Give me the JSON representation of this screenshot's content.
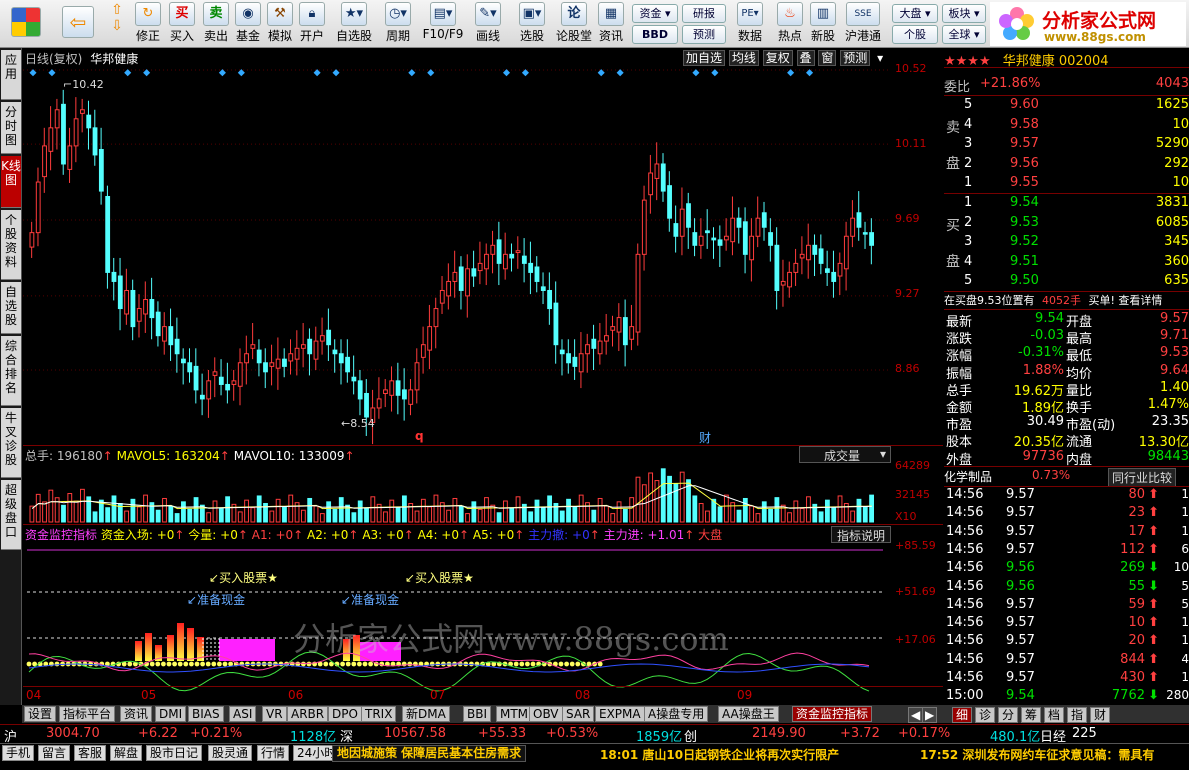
{
  "toolbar": {
    "buy": "买入",
    "sell": "卖出",
    "fund": "基金",
    "simulate": "模拟",
    "open_account": "开户",
    "fix": "修正",
    "watchlist": "自选股",
    "period": "周期",
    "f10": "F10/F9",
    "draw": "画线",
    "stock_pick": "选股",
    "forum": "论股堂",
    "info": "资讯",
    "funds_btn": "资金",
    "bbd": "BBD",
    "research": "研报",
    "forecast": "预测",
    "data": "数据",
    "hot": "热点",
    "new_stock": "新股",
    "hk_connect": "沪港通",
    "market_big": "大盘",
    "individual": "个股",
    "sector": "板块",
    "global": "全球",
    "logo_title": "分析家公式网",
    "logo_url": "www.88gs.com"
  },
  "left_tabs": [
    "应用",
    "分时图",
    "K线图",
    "个股资料",
    "自选股",
    "综合排名",
    "牛叉诊股",
    "超级盘口"
  ],
  "chart": {
    "kline_label": "日线(复权)",
    "stock_name": "华邦健康",
    "buttons": [
      "加自选",
      "均线",
      "复权",
      "叠",
      "窗",
      "预测"
    ],
    "high_label": "10.42",
    "low_label": "8.54",
    "price_axis": [
      "10.52",
      "10.11",
      "9.69",
      "9.27",
      "8.86"
    ],
    "marker_q": "q",
    "marker_cai": "财",
    "vol_title": "总手: 196180",
    "vol_ma5": "MAVOL5: 163204",
    "vol_ma10": "MAVOL10: 133009",
    "vol_selector": "成交量",
    "vol_axis": [
      "64289",
      "32145",
      "X10"
    ],
    "ind_title": "资金监控指标",
    "ind_entry": "资金入场: +0",
    "ind_today": "今量: +0",
    "ind_a1": "A1: +0",
    "ind_a2": "A2: +0",
    "ind_a3": "A3: +0",
    "ind_a4": "A4: +0",
    "ind_a5": "A5: +0",
    "ind_main_out": "主力撤: +0",
    "ind_main_in": "主力进: +1.01",
    "ind_big": "大盘",
    "ind_explain": "指标说明",
    "ind_axis": [
      "+85.59",
      "+51.69",
      "+17.06"
    ],
    "ann_buy1": "买入股票★",
    "ann_buy2": "买入股票★",
    "ann_cash1": "准备现金",
    "ann_cash2": "准备现金",
    "watermark": "分析家公式网www.88gs.com",
    "months": [
      "04",
      "05",
      "06",
      "07",
      "08",
      "09"
    ]
  },
  "right": {
    "header": "华邦健康 002004",
    "weibi_label": "委比",
    "weibi_value": "+21.86%",
    "weibi_extra": "4043",
    "sell_label": "卖盘",
    "buy_label": "买盘",
    "sell_levels": [
      {
        "n": "5",
        "price": "9.60",
        "vol": "1625"
      },
      {
        "n": "4",
        "price": "9.58",
        "vol": "10"
      },
      {
        "n": "3",
        "price": "9.57",
        "vol": "5290"
      },
      {
        "n": "2",
        "price": "9.56",
        "vol": "292"
      },
      {
        "n": "1",
        "price": "9.55",
        "vol": "10"
      }
    ],
    "buy_levels": [
      {
        "n": "1",
        "price": "9.54",
        "vol": "3831"
      },
      {
        "n": "2",
        "price": "9.53",
        "vol": "6085"
      },
      {
        "n": "3",
        "price": "9.52",
        "vol": "345"
      },
      {
        "n": "4",
        "price": "9.51",
        "vol": "360"
      },
      {
        "n": "5",
        "price": "9.50",
        "vol": "635"
      }
    ],
    "order_info": "在买盘9.53位置有",
    "order_vol": "4052手",
    "order_action": "买单! 查看详情",
    "stats": [
      {
        "l1": "最新",
        "v1": "9.54",
        "l2": "开盘",
        "v2": "9.57"
      },
      {
        "l1": "涨跌",
        "v1": "-0.03",
        "l2": "最高",
        "v2": "9.71"
      },
      {
        "l1": "涨幅",
        "v1": "-0.31%",
        "l2": "最低",
        "v2": "9.53"
      },
      {
        "l1": "振幅",
        "v1": "1.88%",
        "l2": "均价",
        "v2": "9.64"
      },
      {
        "l1": "总手",
        "v1": "19.62万",
        "l2": "量比",
        "v2": "1.40"
      },
      {
        "l1": "金额",
        "v1": "1.89亿",
        "l2": "换手",
        "v2": "1.47%"
      },
      {
        "l1": "市盈",
        "v1": "30.49",
        "l2": "市盈(动)",
        "v2": "23.35"
      },
      {
        "l1": "股本",
        "v1": "20.35亿",
        "l2": "流通",
        "v2": "13.30亿"
      },
      {
        "l1": "外盘",
        "v1": "97736",
        "l2": "内盘",
        "v2": "98443"
      }
    ],
    "industry": "化学制品",
    "industry_pct": "0.73%",
    "industry_cmp": "同行业比较",
    "ticks": [
      {
        "t": "14:56",
        "p": "9.57",
        "v": "80",
        "d": "up",
        "e": "1"
      },
      {
        "t": "14:56",
        "p": "9.57",
        "v": "23",
        "d": "up",
        "e": "1"
      },
      {
        "t": "14:56",
        "p": "9.57",
        "v": "17",
        "d": "up",
        "e": "1"
      },
      {
        "t": "14:56",
        "p": "9.57",
        "v": "112",
        "d": "up",
        "e": "6"
      },
      {
        "t": "14:56",
        "p": "9.56",
        "v": "269",
        "d": "down",
        "e": "10"
      },
      {
        "t": "14:56",
        "p": "9.56",
        "v": "55",
        "d": "down",
        "e": "5"
      },
      {
        "t": "14:56",
        "p": "9.57",
        "v": "59",
        "d": "up",
        "e": "5"
      },
      {
        "t": "14:56",
        "p": "9.57",
        "v": "10",
        "d": "up",
        "e": "1"
      },
      {
        "t": "14:56",
        "p": "9.57",
        "v": "20",
        "d": "up",
        "e": "1"
      },
      {
        "t": "14:56",
        "p": "9.57",
        "v": "844",
        "d": "up",
        "e": "4"
      },
      {
        "t": "14:56",
        "p": "9.57",
        "v": "430",
        "d": "up",
        "e": "1"
      },
      {
        "t": "15:00",
        "p": "9.54",
        "v": "7762",
        "d": "down",
        "e": "280"
      }
    ],
    "bottom_tabs": [
      "细",
      "诊",
      "分",
      "筹",
      "档",
      "指",
      "财"
    ]
  },
  "bottom_tabs": [
    "设置",
    "指标平台",
    "资讯",
    "DMI",
    "BIAS",
    "ASI",
    "VR",
    "ARBR",
    "DPO",
    "TRIX",
    "新DMA",
    "BBI",
    "MTM",
    "OBV",
    "SAR",
    "EXPMA",
    "A操盘专用",
    "AA操盘王",
    "资金监控指标"
  ],
  "index_bar": {
    "sh": "沪",
    "sh_val": "3004.70",
    "sh_chg": "+6.22",
    "sh_pct": "+0.21%",
    "sh_amt": "1128亿",
    "sz": "深",
    "sz_val": "10567.58",
    "sz_chg": "+55.33",
    "sz_pct": "+0.53%",
    "sz_amt": "1859亿",
    "cy": "创",
    "cy_val": "2149.90",
    "cy_chg": "+3.72",
    "cy_pct": "+0.17%",
    "cy_amt": "480.1亿",
    "rj": "日经",
    "rj_val": "225"
  },
  "status": {
    "items": [
      "手机",
      "留言",
      "客服",
      "解盘",
      "股市日记",
      "股灵通",
      "行情",
      "24小时滚动"
    ],
    "news1": "地因城施策 保障居民基本住房需求",
    "news2": "18:01 唐山10日起钢铁企业将再次实行限产",
    "news3": "17:52 深圳发布网约车征求意见稿：需具有"
  },
  "chart_data": {
    "type": "candlestick",
    "title": "华邦健康 日线(复权)",
    "y_ticks": [
      10.52,
      10.11,
      9.69,
      9.27,
      8.86
    ],
    "ylim": [
      8.45,
      10.6
    ],
    "x_ticks": [
      "04",
      "05",
      "06",
      "07",
      "08",
      "09"
    ],
    "high": 10.42,
    "low": 8.54,
    "close_series": [
      9.62,
      9.9,
      10.1,
      10.2,
      10.3,
      10.0,
      10.1,
      10.25,
      10.3,
      10.2,
      10.05,
      9.85,
      9.4,
      9.35,
      9.2,
      9.3,
      9.1,
      9.2,
      9.25,
      9.15,
      9.05,
      9.1,
      9.0,
      8.95,
      8.9,
      8.85,
      8.75,
      8.7,
      8.8,
      8.85,
      8.78,
      8.75,
      8.8,
      8.9,
      8.95,
      9.0,
      8.9,
      8.85,
      8.9,
      8.92,
      8.88,
      8.95,
      8.98,
      9.0,
      8.95,
      9.02,
      9.05,
      9.0,
      8.95,
      8.9,
      8.85,
      8.8,
      8.7,
      8.6,
      8.65,
      8.7,
      8.75,
      8.8,
      8.72,
      8.7,
      8.75,
      8.9,
      9.0,
      9.1,
      9.2,
      9.3,
      9.35,
      9.4,
      9.3,
      9.42,
      9.38,
      9.45,
      9.5,
      9.55,
      9.45,
      9.5,
      9.48,
      9.52,
      9.45,
      9.4,
      9.35,
      9.3,
      9.2,
      9.0,
      8.95,
      8.9,
      8.88,
      8.95,
      9.0,
      8.98,
      9.02,
      9.05,
      9.1,
      9.15,
      9.0,
      9.1,
      9.5,
      9.8,
      9.95,
      10.0,
      9.85,
      9.7,
      9.6,
      9.75,
      9.65,
      9.55,
      9.6,
      9.62,
      9.58,
      9.55,
      9.6,
      9.7,
      9.65,
      9.5,
      9.6,
      9.7,
      9.65,
      9.55,
      9.3,
      9.35,
      9.4,
      9.45,
      9.5,
      9.55,
      9.5,
      9.45,
      9.4,
      9.35,
      9.45,
      9.6,
      9.7,
      9.65,
      9.62,
      9.55
    ],
    "volume_axis": [
      64289,
      32145
    ],
    "mavol5": 163204,
    "mavol10": 133009,
    "total_volume": 196180
  }
}
